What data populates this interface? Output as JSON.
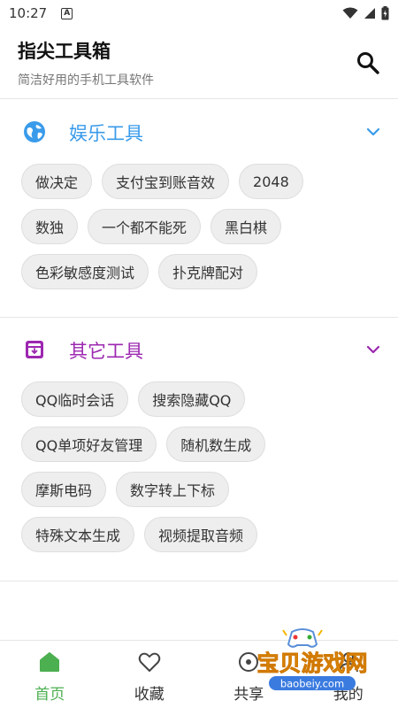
{
  "status": {
    "time": "10:27"
  },
  "header": {
    "title": "指尖工具箱",
    "subtitle": "简洁好用的手机工具软件"
  },
  "colors": {
    "section1": "#3a9bea",
    "section2": "#9c27b0",
    "active": "#4caf50"
  },
  "sections": [
    {
      "title": "娱乐工具",
      "icon": "globe-icon",
      "rows": [
        [
          "做决定",
          "支付宝到账音效",
          "2048"
        ],
        [
          "数独",
          "一个都不能死",
          "黑白棋"
        ],
        [
          "色彩敏感度测试",
          "扑克牌配对"
        ]
      ]
    },
    {
      "title": "其它工具",
      "icon": "archive-box-icon",
      "rows": [
        [
          "QQ临时会话",
          "搜索隐藏QQ"
        ],
        [
          "QQ单项好友管理",
          "随机数生成"
        ],
        [
          "摩斯电码",
          "数字转上下标"
        ],
        [
          "特殊文本生成",
          "视频提取音频"
        ]
      ]
    }
  ],
  "bottom_nav": [
    {
      "label": "首页",
      "icon": "home-icon",
      "active": true
    },
    {
      "label": "收藏",
      "icon": "heart-icon",
      "active": false
    },
    {
      "label": "共享",
      "icon": "share-icon",
      "active": false
    },
    {
      "label": "我的",
      "icon": "person-icon",
      "active": false
    }
  ],
  "watermark": {
    "text": "宝贝游戏网",
    "url": "baobeiy.com"
  }
}
